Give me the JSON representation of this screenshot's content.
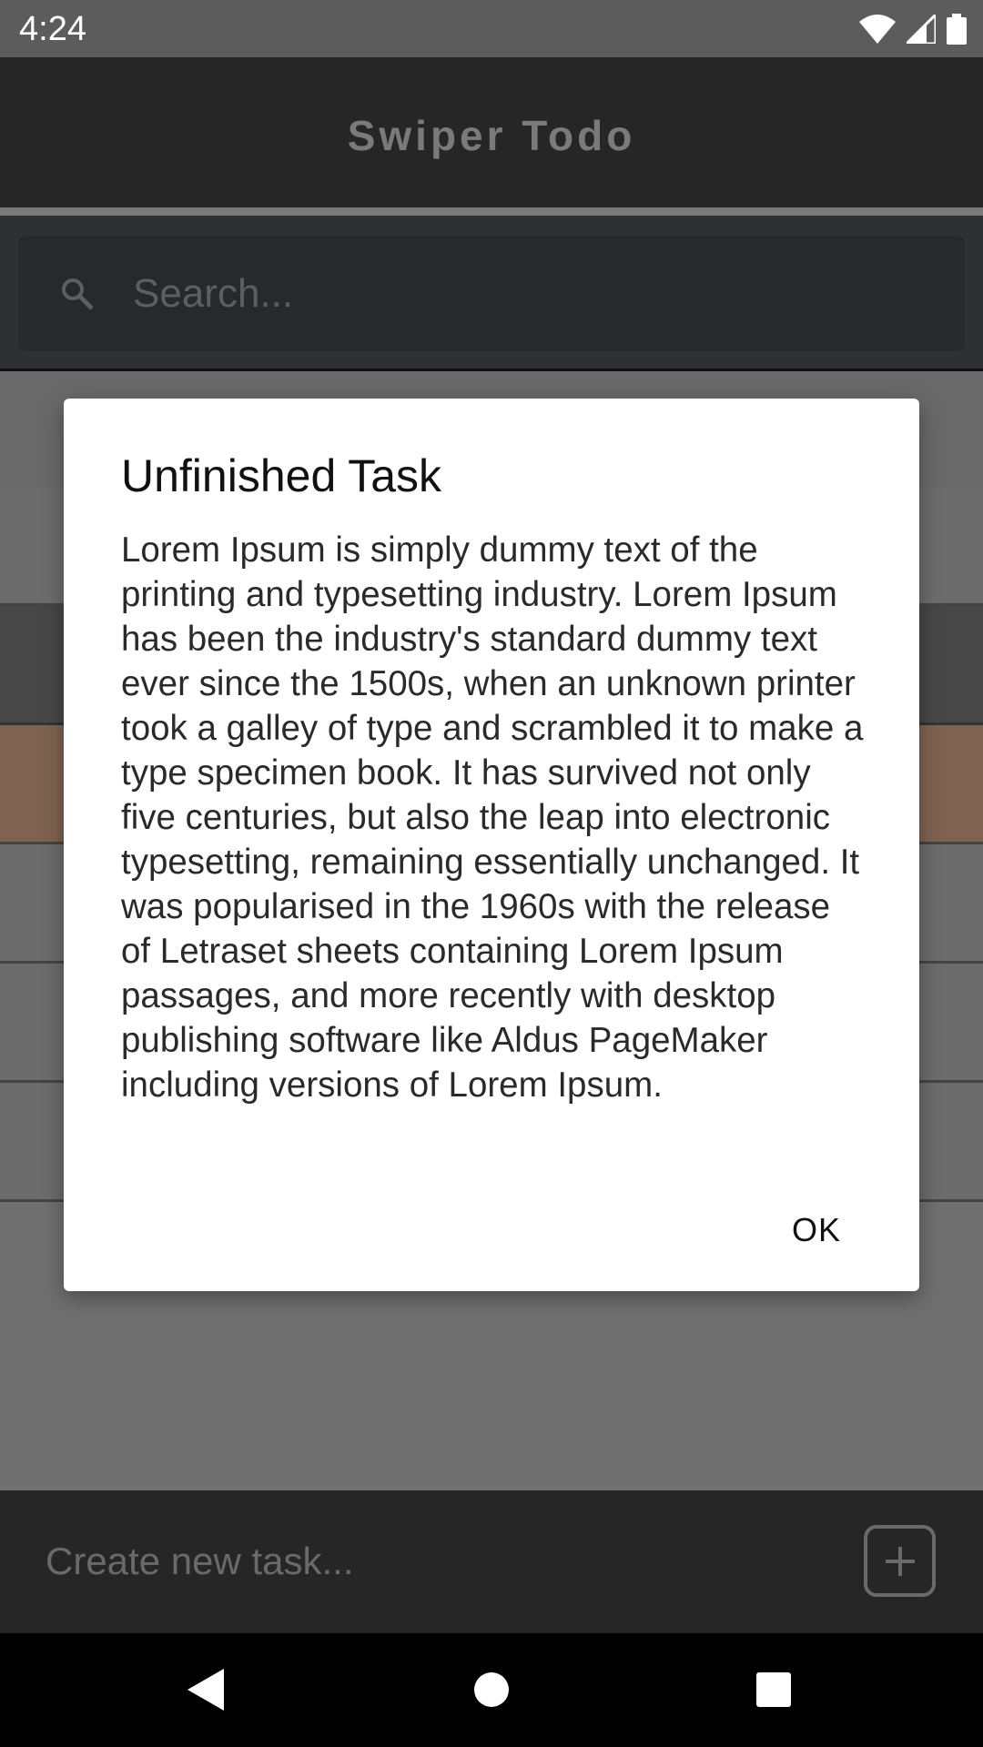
{
  "status_bar": {
    "time": "4:24",
    "icons": [
      "wifi-icon",
      "signal-icon",
      "battery-icon"
    ]
  },
  "app": {
    "title": "Swiper Todo",
    "search": {
      "placeholder": "Search..."
    },
    "new_task": {
      "placeholder": "Create new task..."
    },
    "colors": {
      "background": "#262626",
      "highlight_row": "#7f6350",
      "dialog": "#ffffff"
    }
  },
  "dialog": {
    "title": "Unfinished Task",
    "body": "Lorem Ipsum is simply dummy text of the printing and typesetting industry. Lorem Ipsum has been the industry's standard dummy text ever since the 1500s, when an unknown printer took a galley of type and scrambled it to make a type specimen book. It has survived not only five centuries, but also the leap into electronic typesetting, remaining essentially unchanged. It was popularised in the 1960s with the release of Letraset sheets containing Lorem Ipsum passages, and more recently with desktop publishing software like Aldus PageMaker including versions of Lorem Ipsum.",
    "ok_label": "OK"
  },
  "nav_bar": {
    "buttons": [
      "back-icon",
      "home-icon",
      "recents-icon"
    ]
  }
}
